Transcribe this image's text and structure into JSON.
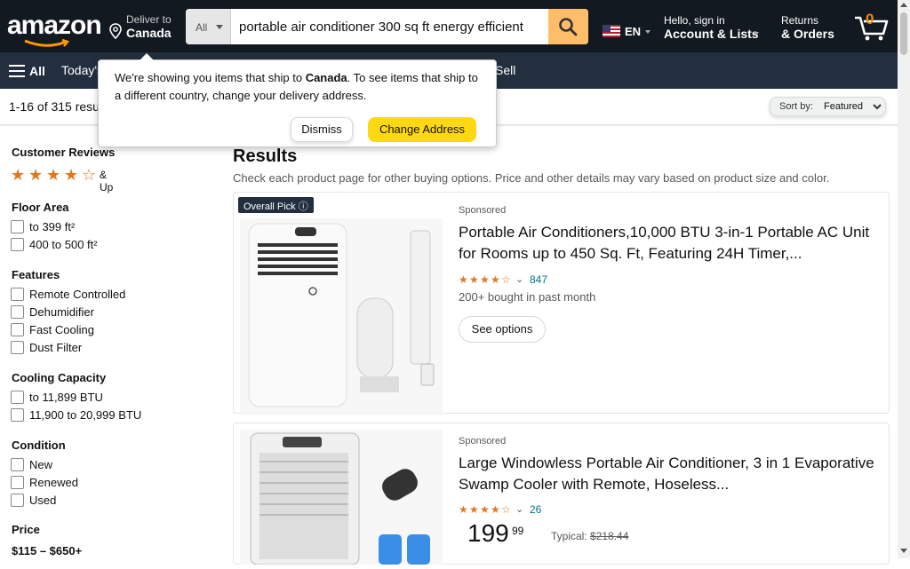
{
  "header": {
    "logo_text": "amazon",
    "deliver_label": "Deliver to",
    "deliver_location": "Canada",
    "search_dept": "All",
    "search_value": "portable air conditioner 300 sq ft energy efficient",
    "lang": "EN",
    "account_l1": "Hello, sign in",
    "account_l2": "Account & Lists",
    "orders_l1": "Returns",
    "orders_l2": "& Orders",
    "cart_count": "0"
  },
  "subnav": {
    "all_label": "All",
    "today_label": "Today's",
    "sell_label": "Sell"
  },
  "resultbar": {
    "count_text": "1-16 of 315 resu",
    "sort_label": "Sort by:",
    "sort_value": "Featured"
  },
  "popover": {
    "msg_a": "We're showing you items that ship to ",
    "msg_country": "Canada",
    "msg_b": ". To see items that ship to a different country, change your delivery address.",
    "dismiss_label": "Dismiss",
    "change_label": "Change Address"
  },
  "sidebar": {
    "reviews_head": "Customer Reviews",
    "reviews_up": "& Up",
    "reviews_stars": 4,
    "floor_head": "Floor Area",
    "floor_items": [
      "to 399 ft²",
      "400 to 500 ft²"
    ],
    "features_head": "Features",
    "features_items": [
      "Remote Controlled",
      "Dehumidifier",
      "Fast Cooling",
      "Dust Filter"
    ],
    "cooling_head": "Cooling Capacity",
    "cooling_items": [
      "to 11,899 BTU",
      "11,900 to 20,999 BTU"
    ],
    "condition_head": "Condition",
    "condition_items": [
      "New",
      "Renewed",
      "Used"
    ],
    "price_head": "Price",
    "price_range": "$115 – $650+"
  },
  "main": {
    "results_head": "Results",
    "results_sub": "Check each product page for other buying options. Price and other details may vary based on product size and color.",
    "products": [
      {
        "badge": "Overall Pick",
        "sponsored": "Sponsored",
        "title": "Portable Air Conditioners,10,000 BTU 3-in-1 Portable AC Unit for Rooms up to 450 Sq. Ft, Featuring 24H Timer,...",
        "stars": 4,
        "rating_count": "847",
        "bought": "200+ bought in past month",
        "see_options": "See options"
      },
      {
        "sponsored": "Sponsored",
        "title": "Large Windowless Portable Air Conditioner, 3 in 1 Evaporative Swamp Cooler with Remote, Hoseless...",
        "stars": 4,
        "rating_count": "26",
        "price_whole": "199",
        "price_frac": "99",
        "typical_label": "Typical: ",
        "typical_price": "$218.44"
      }
    ]
  },
  "colors": {
    "nav_dark": "#131921",
    "nav_sub": "#232f3e",
    "search_btn": "#febd69",
    "star": "#de7921",
    "primary_btn": "#ffd814",
    "link": "#007185"
  }
}
